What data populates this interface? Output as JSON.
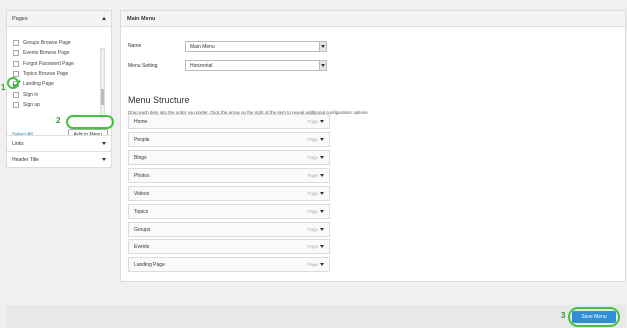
{
  "left_panel": {
    "title": "Pages",
    "pages": [
      {
        "label": "Groups Browse Page",
        "checked": false
      },
      {
        "label": "Events Browse Page",
        "checked": false
      },
      {
        "label": "Forgot Password Page",
        "checked": false
      },
      {
        "label": "Topics Browse Page",
        "checked": false
      },
      {
        "label": "Landing Page",
        "checked": true
      },
      {
        "label": "Sign in",
        "checked": false
      },
      {
        "label": "Sign up",
        "checked": false
      }
    ],
    "select_all": "Select All",
    "add_to_menu": "Add to Menu",
    "links_label": "Links",
    "header_title_label": "Header Title"
  },
  "main": {
    "panel_title": "Main Menu",
    "name_label": "Name",
    "name_value": "Main Menu",
    "menu_setting_label": "Menu Setting",
    "menu_setting_value": "Horizontal",
    "structure_title": "Menu Structure",
    "structure_desc": "Drag each item into the order you prefer. Click the arrow on the right of the item to reveal additional configuration options.",
    "items": [
      {
        "label": "Home",
        "type": "Page"
      },
      {
        "label": "People",
        "type": "Page"
      },
      {
        "label": "Blogs",
        "type": "Page"
      },
      {
        "label": "Photos",
        "type": "Page"
      },
      {
        "label": "Videos",
        "type": "Page"
      },
      {
        "label": "Topics",
        "type": "Page"
      },
      {
        "label": "Groups",
        "type": "Page"
      },
      {
        "label": "Events",
        "type": "Page"
      },
      {
        "label": "Landing Page",
        "type": "Page"
      }
    ]
  },
  "footer": {
    "save_menu": "Save Menu"
  },
  "steps": [
    "1",
    "2",
    "3"
  ],
  "colors": {
    "highlight": "#44c244",
    "primary_button": "#2f8fd8",
    "link": "#2a7ab0"
  }
}
